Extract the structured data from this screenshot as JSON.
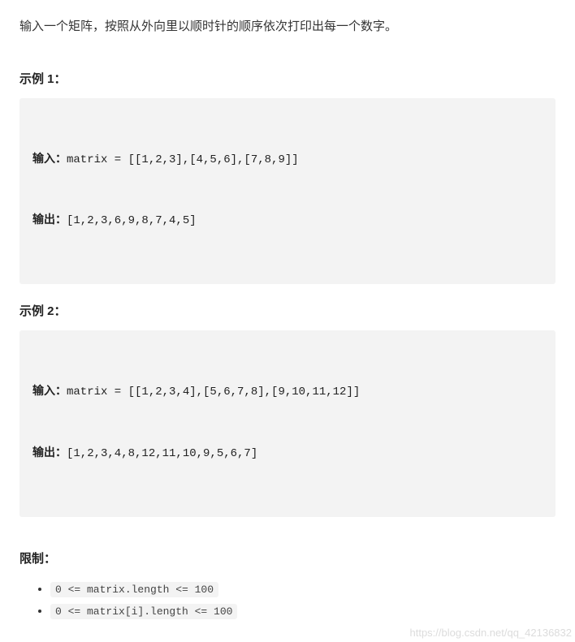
{
  "intro": "输入一个矩阵，按照从外向里以顺时针的顺序依次打印出每一个数字。",
  "example1": {
    "heading": "示例 1：",
    "input_label": "输入：",
    "input_value": "matrix = [[1,2,3],[4,5,6],[7,8,9]]",
    "output_label": "输出：",
    "output_value": "[1,2,3,6,9,8,7,4,5]"
  },
  "example2": {
    "heading": "示例 2：",
    "input_label": "输入：",
    "input_value": "matrix = [[1,2,3,4],[5,6,7,8],[9,10,11,12]]",
    "output_label": "输出：",
    "output_value": "[1,2,3,4,8,12,11,10,9,5,6,7]"
  },
  "limits": {
    "heading": "限制：",
    "items": [
      "0 <= matrix.length <= 100",
      "0 <= matrix[i].length  <= 100"
    ]
  },
  "watermark": "https://blog.csdn.net/qq_42136832"
}
